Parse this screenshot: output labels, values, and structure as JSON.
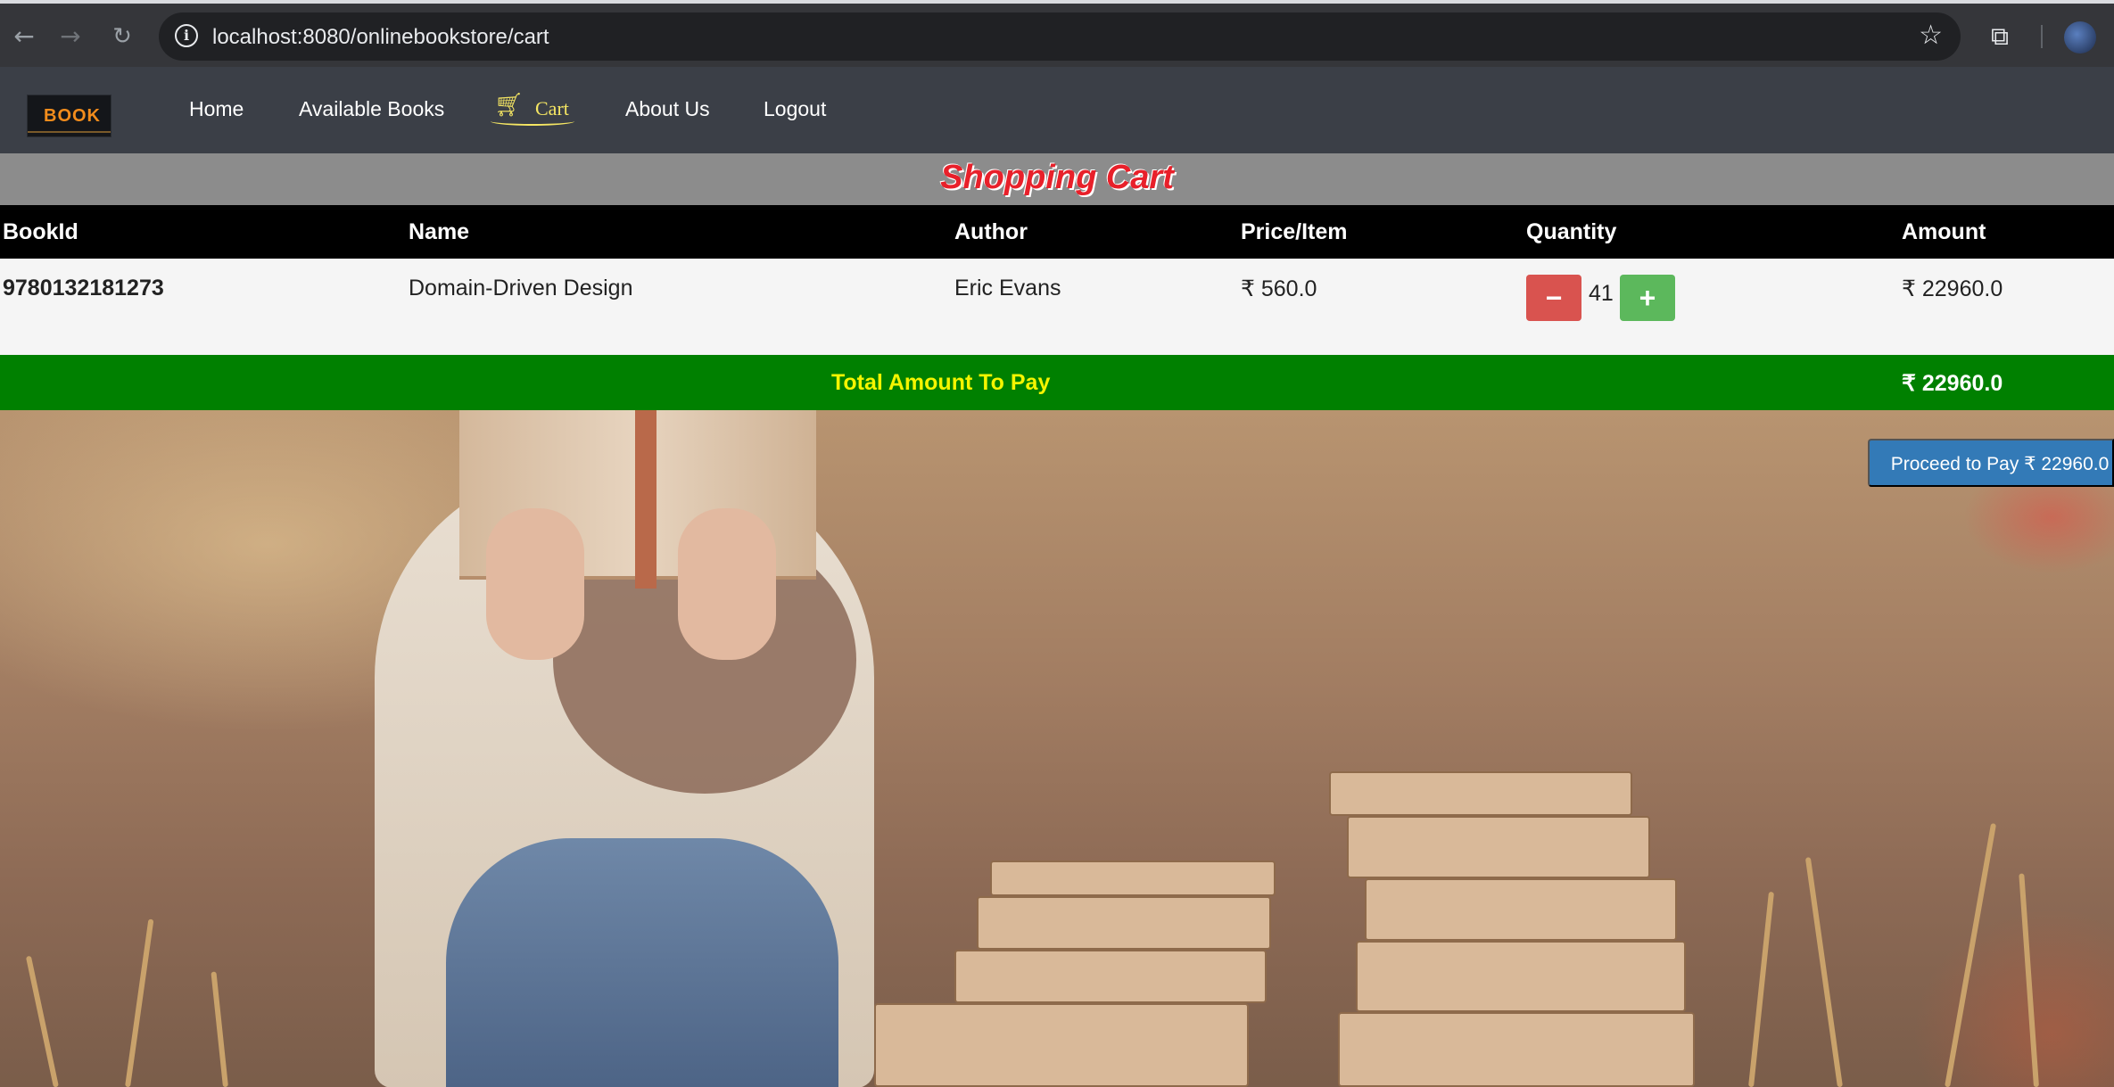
{
  "browser": {
    "url": "localhost:8080/onlinebookstore/cart",
    "back_icon": "arrow-left-icon",
    "forward_icon": "arrow-right-icon",
    "reload_icon": "reload-icon",
    "info_icon": "info-icon",
    "star_icon": "star-icon",
    "extensions_icon": "puzzle-icon"
  },
  "navbar": {
    "logo_text": "BOOK",
    "links": {
      "home": "Home",
      "available_books": "Available Books",
      "cart": "Cart",
      "about_us": "About Us",
      "logout": "Logout"
    },
    "cart_icon": "shopping-cart-icon",
    "active": "Cart"
  },
  "cart": {
    "title": "Shopping Cart",
    "columns": [
      "BookId",
      "Name",
      "Author",
      "Price/Item",
      "Quantity",
      "Amount"
    ],
    "rows": [
      {
        "book_id": "9780132181273",
        "name": "Domain-Driven Design",
        "author": "Eric Evans",
        "price": "₹ 560.0",
        "quantity": "41",
        "amount": "₹ 22960.0"
      }
    ],
    "minus_label": "−",
    "plus_label": "+",
    "total_label": "Total Amount To Pay",
    "total_value": "₹ 22960.0",
    "pay_button": "Proceed to Pay ₹ 22960.0"
  },
  "colors": {
    "navbar": "#3b3f47",
    "title_bar": "#8c8c8c",
    "title_text": "#e8202a",
    "table_header": "#000000",
    "total_bar": "#008000",
    "total_label": "#f5f500",
    "minus_button": "#d9534f",
    "plus_button": "#5cb85c",
    "pay_button": "#337ab7",
    "cart_link": "#f5e663"
  }
}
